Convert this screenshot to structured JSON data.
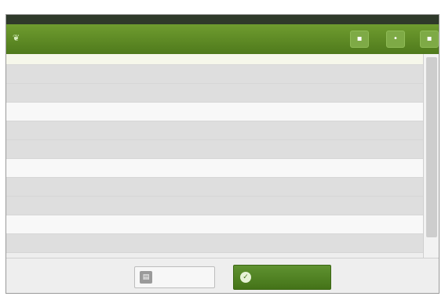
{
  "window": {
    "title": ""
  },
  "titlebar_buttons": [
    {
      "name": "left-button",
      "glyph": "▪"
    },
    {
      "name": "middle-button",
      "glyph": "•"
    },
    {
      "name": "right-button",
      "glyph": "▪"
    }
  ],
  "search": {
    "placeholder": ""
  },
  "rows": [
    {
      "kind": "item",
      "label": "",
      "value": "",
      "value_dim": true
    },
    {
      "kind": "item",
      "label": "",
      "value": ""
    },
    {
      "kind": "header",
      "label": "",
      "value": ""
    },
    {
      "kind": "item",
      "label": "",
      "value": ""
    },
    {
      "kind": "item",
      "label": "",
      "value": ""
    },
    {
      "kind": "header",
      "label": "",
      "value": ""
    },
    {
      "kind": "item",
      "label": "",
      "value": ""
    },
    {
      "kind": "item",
      "label": "",
      "value": ""
    },
    {
      "kind": "header",
      "label": "",
      "value": ""
    },
    {
      "kind": "item",
      "label": "",
      "value": ""
    }
  ],
  "footer": {
    "filter_button_label": "",
    "primary_button_label": ""
  },
  "colors": {
    "accent": "#5a8a24",
    "titlebar": "#5f8c25"
  },
  "icons": {
    "app": "leaf-icon",
    "filter": "filter-icon",
    "primary": "check-icon"
  }
}
